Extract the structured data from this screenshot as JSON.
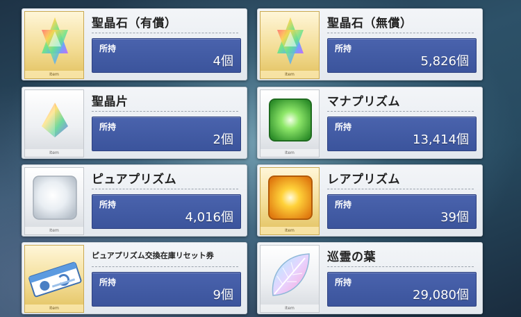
{
  "labels": {
    "item_tag": "Item",
    "held": "所持"
  },
  "items": [
    {
      "name": "聖晶石（有償）",
      "value": "4個",
      "frame": "gold",
      "icon": "saint-quartz-icon"
    },
    {
      "name": "聖晶石（無償）",
      "value": "5,826個",
      "frame": "gold",
      "icon": "saint-quartz-icon"
    },
    {
      "name": "聖晶片",
      "value": "2個",
      "frame": "silver",
      "icon": "quartz-fragment-icon"
    },
    {
      "name": "マナプリズム",
      "value": "13,414個",
      "frame": "silver",
      "icon": "mana-prism-icon"
    },
    {
      "name": "ピュアプリズム",
      "value": "4,016個",
      "frame": "silver",
      "icon": "pure-prism-icon"
    },
    {
      "name": "レアプリズム",
      "value": "39個",
      "frame": "gold",
      "icon": "rare-prism-icon"
    },
    {
      "name": "ピュアプリズム交換在庫リセット券",
      "value": "9個",
      "frame": "gold",
      "icon": "reset-ticket-icon"
    },
    {
      "name": "巡霊の葉",
      "value": "29,080個",
      "frame": "silver",
      "icon": "leaf-icon"
    }
  ],
  "colors": {
    "panel": "#3f58a2",
    "gold_frame": "#e2c15f",
    "silver_frame": "#d5d9de"
  }
}
